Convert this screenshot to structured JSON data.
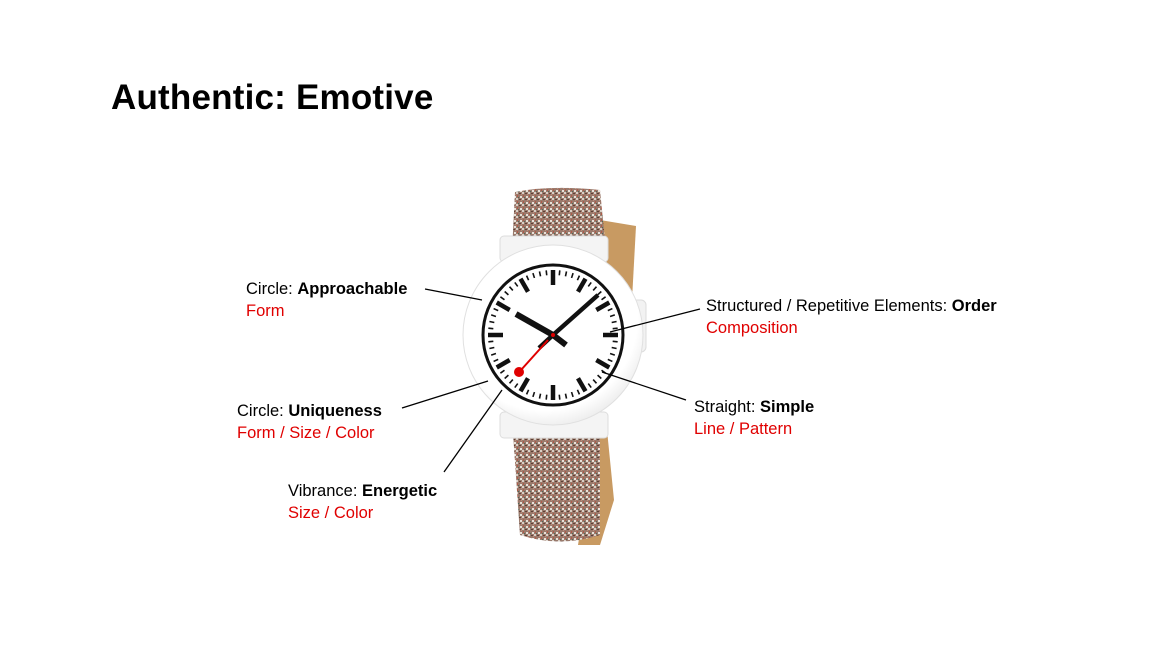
{
  "title": "Authentic: Emotive",
  "annotations": [
    {
      "id": "approachable",
      "prefix": "Circle: ",
      "bold": "Approachable",
      "sub": "Form"
    },
    {
      "id": "uniqueness",
      "prefix": "Circle: ",
      "bold": "Uniqueness",
      "sub": "Form / Size / Color"
    },
    {
      "id": "energetic",
      "prefix": "Vibrance: ",
      "bold": "Energetic",
      "sub": "Size / Color"
    },
    {
      "id": "order",
      "prefix": "Structured / Repetitive Elements: ",
      "bold": "Order",
      "sub": "Composition"
    },
    {
      "id": "simple",
      "prefix": "Straight: ",
      "bold": "Simple",
      "sub": "Line / Pattern"
    }
  ],
  "colors": {
    "accent": "#e00000",
    "strap": "#9a7a6c",
    "cork": "#c89a62",
    "case": "#ffffff",
    "dial": "#ffffff",
    "marker": "#111111",
    "second_hand": "#e00000"
  }
}
